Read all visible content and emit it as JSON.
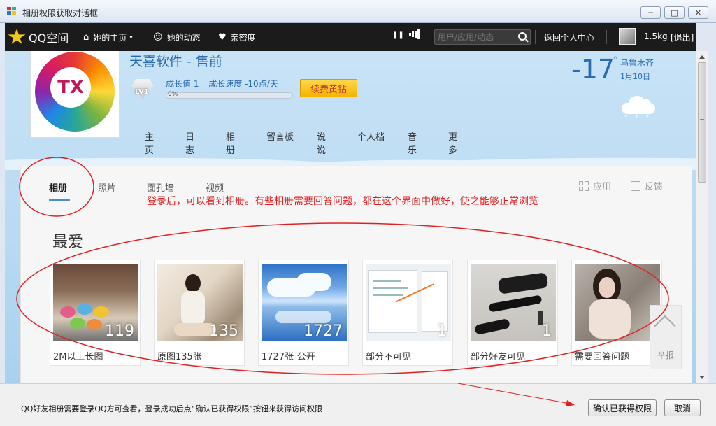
{
  "window": {
    "title": "相册权限获取对话框",
    "min_glyph": "─",
    "max_glyph": "□",
    "close_glyph": "✕"
  },
  "qzone": {
    "logo_text": "QQ空间",
    "nav": [
      {
        "label": "她的主页",
        "icon": "home-icon",
        "glyph": "⌂",
        "caret": "▾"
      },
      {
        "label": "她的动态",
        "icon": "friends-icon",
        "glyph": "☺"
      },
      {
        "label": "亲密度",
        "icon": "heart-icon",
        "glyph": "♥"
      }
    ],
    "pause_glyph": "❚❚",
    "signal_glyph": "▮",
    "search_placeholder": "用户/应用/动态",
    "back_label": "返回个人中心",
    "weight": "1.5kg",
    "exit_label": "[退出]"
  },
  "profile": {
    "name": "天喜软件 - 售前",
    "avatar_text": "TX",
    "level": "LV1",
    "growth_value": "成长值 1",
    "growth_speed": "成长速度 -10点/天",
    "progress_label": "0%",
    "progress": 0,
    "renew_label": "续费黄钻",
    "subnav": [
      "主页",
      "日志",
      "相册",
      "留言板",
      "说说",
      "个人档",
      "音乐",
      "更多"
    ]
  },
  "weather": {
    "temp": "-17",
    "deg": "°",
    "city": "乌鲁木齐",
    "date": "1月10日",
    "flakes": "* * *",
    "icon": "snow-cloud-icon"
  },
  "albums_panel": {
    "tabs": [
      "相册",
      "照片",
      "面孔墙",
      "视频"
    ],
    "active_tab": "相册",
    "tool_apps": "应用",
    "tool_feedback": "反馈",
    "section_title": "最爱",
    "albums": [
      {
        "name": "2M以上长图",
        "count": "119"
      },
      {
        "name": "原图135张",
        "count": "135"
      },
      {
        "name": "1727张-公开",
        "count": "1727"
      },
      {
        "name": "部分不可见",
        "count": "1"
      },
      {
        "name": "部分好友可见",
        "count": "1"
      },
      {
        "name": "需要回答问题",
        "count": ""
      }
    ],
    "report_label": "举报"
  },
  "annotation": {
    "text": "登录后，可以看到相册。有些相册需要回答问题，都在这个界面中做好，使之能够正常浏览",
    "color": "#e02020"
  },
  "footer": {
    "message": "QQ好友相册需要登录QQ方可查看，登录成功后点“确认已获得权限”按钮来获得访问权限",
    "confirm_label": "确认已获得权限",
    "cancel_label": "取消"
  }
}
